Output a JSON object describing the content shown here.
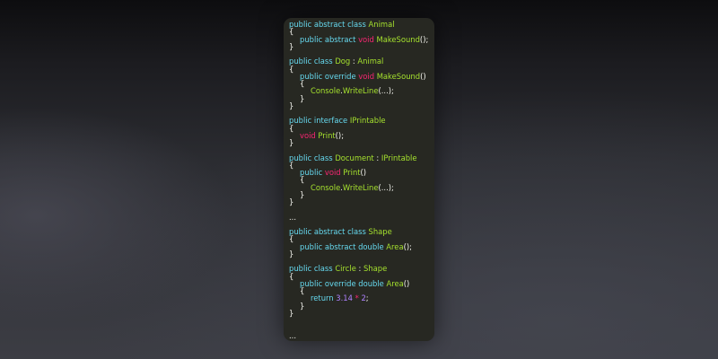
{
  "code": {
    "lines": [
      {
        "indent": 0,
        "tokens": [
          {
            "t": "public abstract class ",
            "c": "kw"
          },
          {
            "t": "Animal",
            "c": "cls"
          }
        ]
      },
      {
        "indent": 0,
        "tokens": [
          {
            "t": "{",
            "c": "pl"
          }
        ]
      },
      {
        "indent": 1,
        "tokens": [
          {
            "t": "public abstract ",
            "c": "kw"
          },
          {
            "t": "void ",
            "c": "void"
          },
          {
            "t": "MakeSound",
            "c": "fn"
          },
          {
            "t": "();",
            "c": "pl"
          }
        ]
      },
      {
        "indent": 0,
        "tokens": [
          {
            "t": "}",
            "c": "pl"
          }
        ]
      },
      {
        "indent": 0,
        "tokens": []
      },
      {
        "indent": 0,
        "tokens": [
          {
            "t": "public class ",
            "c": "kw"
          },
          {
            "t": "Dog",
            "c": "cls"
          },
          {
            "t": " : ",
            "c": "pl"
          },
          {
            "t": "Animal",
            "c": "cls"
          }
        ]
      },
      {
        "indent": 0,
        "tokens": [
          {
            "t": "{",
            "c": "pl"
          }
        ]
      },
      {
        "indent": 1,
        "tokens": [
          {
            "t": "public override ",
            "c": "kw"
          },
          {
            "t": "void ",
            "c": "void"
          },
          {
            "t": "MakeSound",
            "c": "fn"
          },
          {
            "t": "()",
            "c": "pl"
          }
        ]
      },
      {
        "indent": 1,
        "tokens": [
          {
            "t": "{",
            "c": "pl"
          }
        ]
      },
      {
        "indent": 2,
        "tokens": [
          {
            "t": "Console",
            "c": "cls"
          },
          {
            "t": ".",
            "c": "pl"
          },
          {
            "t": "WriteLine",
            "c": "fn"
          },
          {
            "t": "(...);",
            "c": "pl"
          }
        ]
      },
      {
        "indent": 1,
        "tokens": [
          {
            "t": "}",
            "c": "pl"
          }
        ]
      },
      {
        "indent": 0,
        "tokens": [
          {
            "t": "}",
            "c": "pl"
          }
        ]
      },
      {
        "indent": 0,
        "tokens": []
      },
      {
        "indent": 0,
        "tokens": [
          {
            "t": "public interface ",
            "c": "kw"
          },
          {
            "t": "IPrintable",
            "c": "cls"
          }
        ]
      },
      {
        "indent": 0,
        "tokens": [
          {
            "t": "{",
            "c": "pl"
          }
        ]
      },
      {
        "indent": 1,
        "tokens": [
          {
            "t": "void ",
            "c": "void"
          },
          {
            "t": "Print",
            "c": "fn"
          },
          {
            "t": "();",
            "c": "pl"
          }
        ]
      },
      {
        "indent": 0,
        "tokens": [
          {
            "t": "}",
            "c": "pl"
          }
        ]
      },
      {
        "indent": 0,
        "tokens": []
      },
      {
        "indent": 0,
        "tokens": [
          {
            "t": "public class ",
            "c": "kw"
          },
          {
            "t": "Document",
            "c": "cls"
          },
          {
            "t": " : ",
            "c": "pl"
          },
          {
            "t": "IPrintable",
            "c": "cls"
          }
        ]
      },
      {
        "indent": 0,
        "tokens": [
          {
            "t": "{",
            "c": "pl"
          }
        ]
      },
      {
        "indent": 1,
        "tokens": [
          {
            "t": "public ",
            "c": "kw"
          },
          {
            "t": "void ",
            "c": "void"
          },
          {
            "t": "Print",
            "c": "fn"
          },
          {
            "t": "()",
            "c": "pl"
          }
        ]
      },
      {
        "indent": 1,
        "tokens": [
          {
            "t": "{",
            "c": "pl"
          }
        ]
      },
      {
        "indent": 2,
        "tokens": [
          {
            "t": "Console",
            "c": "cls"
          },
          {
            "t": ".",
            "c": "pl"
          },
          {
            "t": "WriteLine",
            "c": "fn"
          },
          {
            "t": "(...);",
            "c": "pl"
          }
        ]
      },
      {
        "indent": 1,
        "tokens": [
          {
            "t": "}",
            "c": "pl"
          }
        ]
      },
      {
        "indent": 0,
        "tokens": [
          {
            "t": "}",
            "c": "pl"
          }
        ]
      },
      {
        "indent": 0,
        "tokens": []
      },
      {
        "indent": 0,
        "tokens": [
          {
            "t": "...",
            "c": "pl"
          }
        ]
      },
      {
        "indent": 0,
        "tokens": []
      },
      {
        "indent": 0,
        "tokens": [
          {
            "t": "public abstract class ",
            "c": "kw"
          },
          {
            "t": "Shape",
            "c": "cls"
          }
        ]
      },
      {
        "indent": 0,
        "tokens": [
          {
            "t": "{",
            "c": "pl"
          }
        ]
      },
      {
        "indent": 1,
        "tokens": [
          {
            "t": "public abstract double ",
            "c": "kw"
          },
          {
            "t": "Area",
            "c": "fn"
          },
          {
            "t": "();",
            "c": "pl"
          }
        ]
      },
      {
        "indent": 0,
        "tokens": [
          {
            "t": "}",
            "c": "pl"
          }
        ]
      },
      {
        "indent": 0,
        "tokens": []
      },
      {
        "indent": 0,
        "tokens": [
          {
            "t": "public class ",
            "c": "kw"
          },
          {
            "t": "Circle",
            "c": "cls"
          },
          {
            "t": " : ",
            "c": "pl"
          },
          {
            "t": "Shape",
            "c": "cls"
          }
        ]
      },
      {
        "indent": 0,
        "tokens": [
          {
            "t": "{",
            "c": "pl"
          }
        ]
      },
      {
        "indent": 1,
        "tokens": [
          {
            "t": "public override double ",
            "c": "kw"
          },
          {
            "t": "Area",
            "c": "fn"
          },
          {
            "t": "()",
            "c": "pl"
          }
        ]
      },
      {
        "indent": 1,
        "tokens": [
          {
            "t": "{",
            "c": "pl"
          }
        ]
      },
      {
        "indent": 2,
        "tokens": [
          {
            "t": "return ",
            "c": "kw"
          },
          {
            "t": "3.14",
            "c": "num"
          },
          {
            "t": " * ",
            "c": "op"
          },
          {
            "t": "2",
            "c": "num"
          },
          {
            "t": ";",
            "c": "pl"
          }
        ]
      },
      {
        "indent": 1,
        "tokens": [
          {
            "t": "}",
            "c": "pl"
          }
        ]
      },
      {
        "indent": 0,
        "tokens": [
          {
            "t": "}",
            "c": "pl"
          }
        ]
      },
      {
        "indent": 0,
        "tokens": []
      },
      {
        "indent": 0,
        "tokens": []
      },
      {
        "indent": 0,
        "tokens": [
          {
            "t": "...",
            "c": "pl"
          }
        ]
      }
    ]
  },
  "colors": {
    "panel_background": "#272822",
    "keyword": "#66d9ef",
    "void_keyword": "#f92672",
    "type_name": "#a6e22e",
    "number": "#ae81ff",
    "plain": "#f8f8f2"
  }
}
